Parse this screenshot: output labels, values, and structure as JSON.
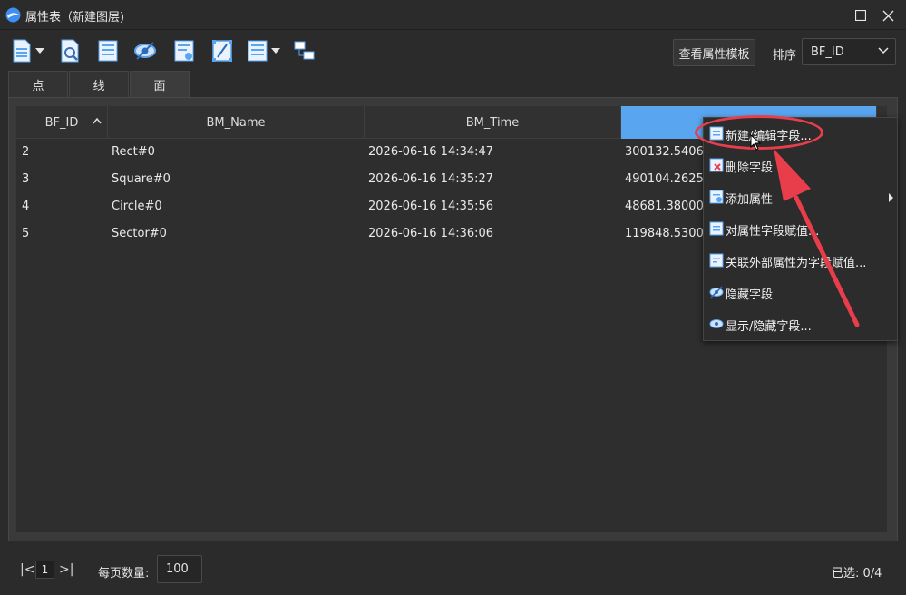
{
  "window": {
    "title": "属性表（新建图层)",
    "controls": [
      "maximize",
      "close"
    ]
  },
  "toolbar": {
    "icons": [
      "save-icon",
      "find-icon",
      "table-icon",
      "hide-icon",
      "field-edit-icon",
      "calculator-icon",
      "list-icon",
      "link-icon"
    ],
    "view_template_label": "查看属性模板",
    "sort_label": "排序",
    "sort_value": "BF_ID"
  },
  "tabs": [
    {
      "label": "点",
      "active": false
    },
    {
      "label": "线",
      "active": false
    },
    {
      "label": "面",
      "active": true
    }
  ],
  "table": {
    "columns": [
      "BF_ID",
      "BM_Name",
      "BM_Time",
      ""
    ],
    "rows": [
      {
        "id": "2",
        "name": "Rect#0",
        "time": "2026-06-16 14:34:47",
        "value": "300132.54060"
      },
      {
        "id": "3",
        "name": "Square#0",
        "time": "2026-06-16 14:35:27",
        "value": "490104.26256"
      },
      {
        "id": "4",
        "name": "Circle#0",
        "time": "2026-06-16 14:35:56",
        "value": "48681.380000"
      },
      {
        "id": "5",
        "name": "Sector#0",
        "time": "2026-06-16 14:36:06",
        "value": "119848.53000"
      }
    ]
  },
  "context_menu": {
    "items": [
      {
        "label": "新建/编辑字段...",
        "icon": "field-new-icon"
      },
      {
        "label": "删除字段",
        "icon": "field-delete-icon"
      },
      {
        "label": "添加属性",
        "icon": "attribute-add-icon",
        "submenu": true
      },
      {
        "label": "对属性字段赋值...",
        "icon": "field-assign-icon"
      },
      {
        "label": "关联外部属性为字段赋值...",
        "icon": "external-link-icon"
      },
      {
        "label": "隐藏字段",
        "icon": "hide-field-icon"
      },
      {
        "label": "显示/隐藏字段...",
        "icon": "show-hide-icon"
      }
    ]
  },
  "footer": {
    "current_page": "1",
    "page_size_label": "每页数量:",
    "page_size": "100",
    "selected": "已选: 0/4"
  },
  "colors": {
    "background": "#2b2b2b",
    "header_selected": "#5aa5f0",
    "annotation": "#e83d4a",
    "icon_blue": "#5aa5f0"
  }
}
